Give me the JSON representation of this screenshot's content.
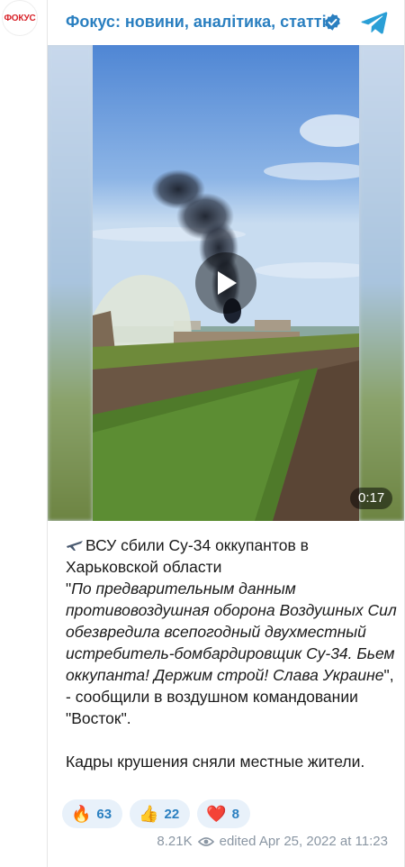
{
  "channel": {
    "avatar_text": "ФОКУС",
    "name": "Фокус: новини, аналітика, статті"
  },
  "video": {
    "duration": "0:17"
  },
  "post": {
    "headline": "ВСУ сбили Су-34 оккупантов в Харьковской области",
    "quote_open": "\"",
    "quote": "По предварительным данным противовоздушная оборона Воздушных Сил обезвредила всепогодный двухместный истребитель-бомбардировщик Су-34. Бьем оккупанта! Держим строй! Слава Украине",
    "quote_close": "\", - сообщили в воздушном командовании \"Восток\".",
    "footer": "Кадры крушения сняли местные жители."
  },
  "reactions": [
    {
      "emoji": "🔥",
      "count": "63"
    },
    {
      "emoji": "👍",
      "count": "22"
    },
    {
      "emoji": "❤️",
      "count": "8"
    }
  ],
  "meta": {
    "views": "8.21K",
    "edited_date": "edited  Apr 25, 2022 at 11:23"
  },
  "colors": {
    "accent": "#2a7fc0",
    "muted": "#8a96a3",
    "reaction_bg": "#e8f1fa"
  }
}
